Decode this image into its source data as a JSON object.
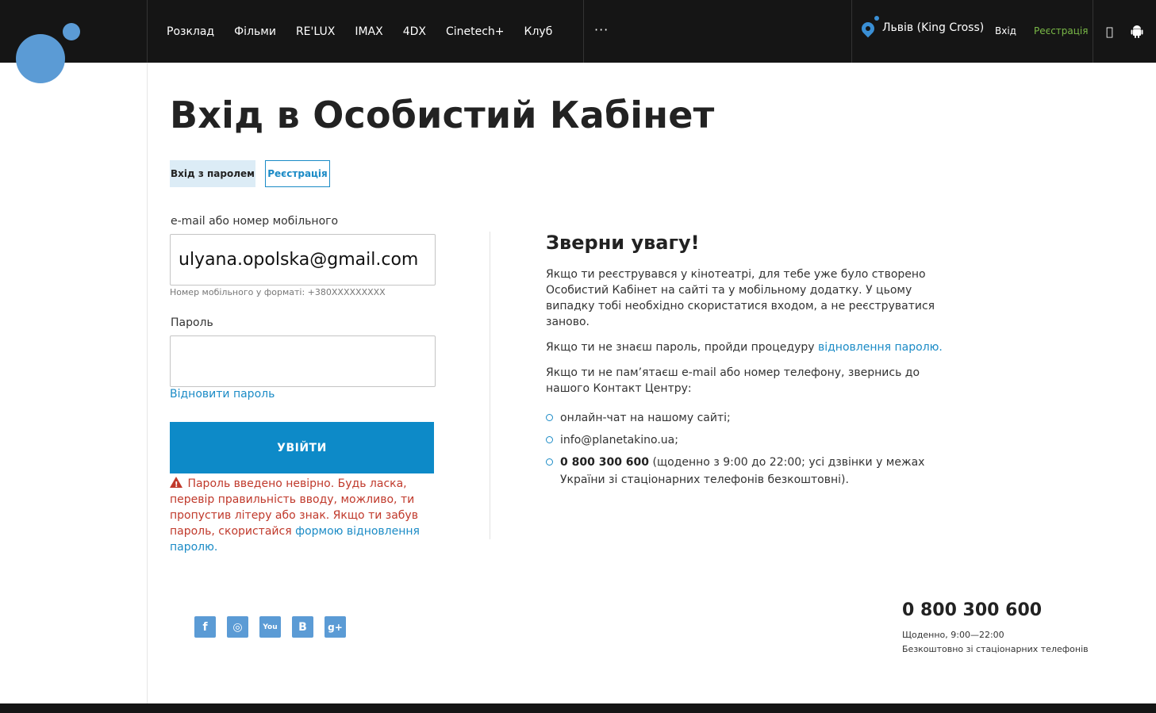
{
  "nav": {
    "items": [
      "Розклад",
      "Фільми",
      "RE'LUX",
      "IMAX",
      "4DX",
      "Cinetech+",
      "Клуб"
    ],
    "more": "···"
  },
  "header": {
    "city": "Львів (King Cross)",
    "login": "Вхід",
    "register": "Реєстрація"
  },
  "page": {
    "title": "Вхід в Особистий Кабінет",
    "tab_login": "Вхід з паролем",
    "tab_register": "Реєстрація"
  },
  "form": {
    "email_label": "e-mail або номер мобільного",
    "email_value": "ulyana.opolska@gmail.com",
    "email_hint": "Номер мобільного у форматі: +380XXXXXXXXX",
    "password_label": "Пароль",
    "password_value": "",
    "restore_link": "Відновити пароль",
    "submit": "УВІЙТИ",
    "error_text": "Пароль введено невірно. Будь ласка, перевір правильність вводу, можливо, ти пропустив літеру або знак. Якщо ти забув пароль, скористайся",
    "error_link": "формою відновлення паролю."
  },
  "notice": {
    "title": "Зверни увагу!",
    "p1": "Якщо ти реєструвався у кінотеатрі, для тебе уже було створено Особистий Кабінет на сайті та у мобільному додатку. У цьому випадку тобі необхідно скористатися входом, а не реєструватися заново.",
    "p2_text": "Якщо ти не знаєш пароль, пройди процедуру",
    "p2_link": "відновлення паролю.",
    "p3": "Якщо ти не пам’ятаєш e-mail або номер телефону, звернись до нашого Контакт Центру:",
    "li1": "онлайн-чат на нашому сайті;",
    "li2": "info@planetakino.ua;",
    "li3_bold": "0 800 300 600",
    "li3_text": " (щоденно з 9:00 до 22:00; усі дзвінки у межах України зі стаціонарних телефонів безкоштовні)."
  },
  "footer": {
    "social": [
      "f",
      "◎",
      "You",
      "B",
      "g+"
    ],
    "phone": "0 800 300 600",
    "hours": "Щоденно, 9:00—22:00",
    "free": "Безкоштовно зі стаціонарних телефонів"
  },
  "colors": {
    "accent": "#0d8ac8",
    "link": "#1b8bc6",
    "error": "#c0392b",
    "register_green": "#7ab947"
  }
}
